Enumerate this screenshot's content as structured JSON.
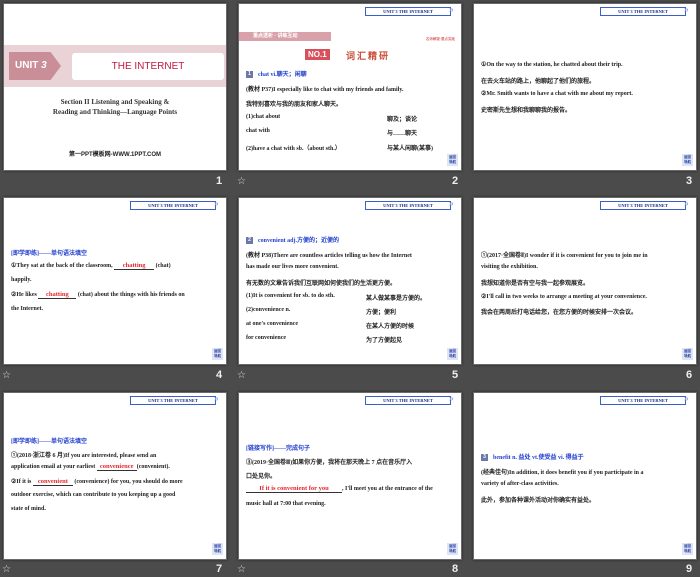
{
  "header_tag": "UNIT 3  THE INTERNET",
  "back_button": "返回导航",
  "back_button_lines": [
    "返回",
    "导航"
  ],
  "slide_numbers": [
    "1",
    "2",
    "3",
    "4",
    "5",
    "6",
    "7",
    "8",
    "9"
  ],
  "star_icon": "☆",
  "s1": {
    "unit": "UNIT",
    "unit_num": "3",
    "title": "THE INTERNET",
    "sub1": "Section II   Listening and Speaking &",
    "sub2": "Reading and Thinking—Language Points",
    "footer": "第一PPT模板网-WWW.1PPT.COM"
  },
  "s2": {
    "bar": "重点透析 · 讲练互动",
    "bar_right": "名师解疑·要点突破",
    "no": "NO.1",
    "heading": "词汇精研",
    "badge": "1",
    "word": "chat    vi.聊天；闲聊",
    "l1": "(教材 P37)I especially like to chat with my friends and family.",
    "l2": "我特别喜欢与我的朋友和家人聊天。",
    "rows": [
      [
        "(1)chat about",
        "聊及；谈论"
      ],
      [
        "chat with",
        "与……聊天"
      ],
      [
        "(2)have a chat with sb.（about sth.）",
        "与某人闲聊(某事)"
      ]
    ]
  },
  "s3": {
    "lines": [
      "①On the way to the station, he chatted about their trip.",
      "在去火车站的路上，他聊起了他们的旅程。",
      "②Mr. Smith wants to have a chat with me about my report.",
      "史密斯先生想和我聊聊我的报告。"
    ]
  },
  "s4": {
    "title": "[即学即练]——单句语法填空",
    "a1": "①They sat at the back of the classroom,",
    "f1": "chatting",
    "a2": "(chat)",
    "a3": "happily.",
    "b1": "②He likes",
    "f2": "chatting",
    "b2": "(chat) about the things with his friends on",
    "b3": "the Internet."
  },
  "s5": {
    "badge": "2",
    "word": "convenient    adj.方便的；近便的",
    "l1": "(教材 P38)There are countless articles telling us how the Internet",
    "l2": "has made our lives more convenient.",
    "l3": "有无数的文章告诉我们互联网如何使我们的生活更方便。",
    "rows": [
      [
        "(1)It is convenient for sb. to do sth.",
        "某人做某事是方便的。"
      ],
      [
        "(2)convenience n.",
        "方便；便利"
      ],
      [
        "at one's convenience",
        "在某人方便的时候"
      ],
      [
        "for convenience",
        "为了方便起见"
      ]
    ]
  },
  "s6": {
    "lines": [
      "①(2017·全国卷Ⅱ)I wonder if it is convenient for you to join me in",
      "visiting the exhibition.",
      "我想知道你是否有空与我一起参观展览。",
      "②I'll call in two weeks to arrange a meeting at your convenience.",
      "我会在两周后打电话给您，在您方便的时候安排一次会议。"
    ]
  },
  "s7": {
    "title": "[即学即练]——单句语法填空",
    "a1": "①(2018·浙江卷 6 月)If you are interested, please send an",
    "a2": "application email at your earliest",
    "f1": "convenience",
    "a3": "(convenient).",
    "b1": "②If it is",
    "f2": "convenient",
    "b2": "(convenience) for you, you should do more",
    "b3": "outdoor exercise, which can contribute to you keeping up a good",
    "b4": "state of mind."
  },
  "s8": {
    "title": "[链接写作]——完成句子",
    "l1": "③(2019·全国卷Ⅲ)如果你方便，我将在那天晚上 7 点在音乐厅入",
    "l2": "口处见你。",
    "f1": "If it is convenient for you",
    "l3": ", I'll meet you at the entrance of the",
    "l4": "music hall at 7:00 that evening."
  },
  "s9": {
    "badge": "3",
    "word": "benefit   n. 益处   vt.使受益   vi. 得益于",
    "l1": "(经典佳句)In addition, it does benefit you if you participate in a",
    "l2": "variety of after-class activities.",
    "l3": "此外，参加各种课外活动对你确实有益处。"
  }
}
